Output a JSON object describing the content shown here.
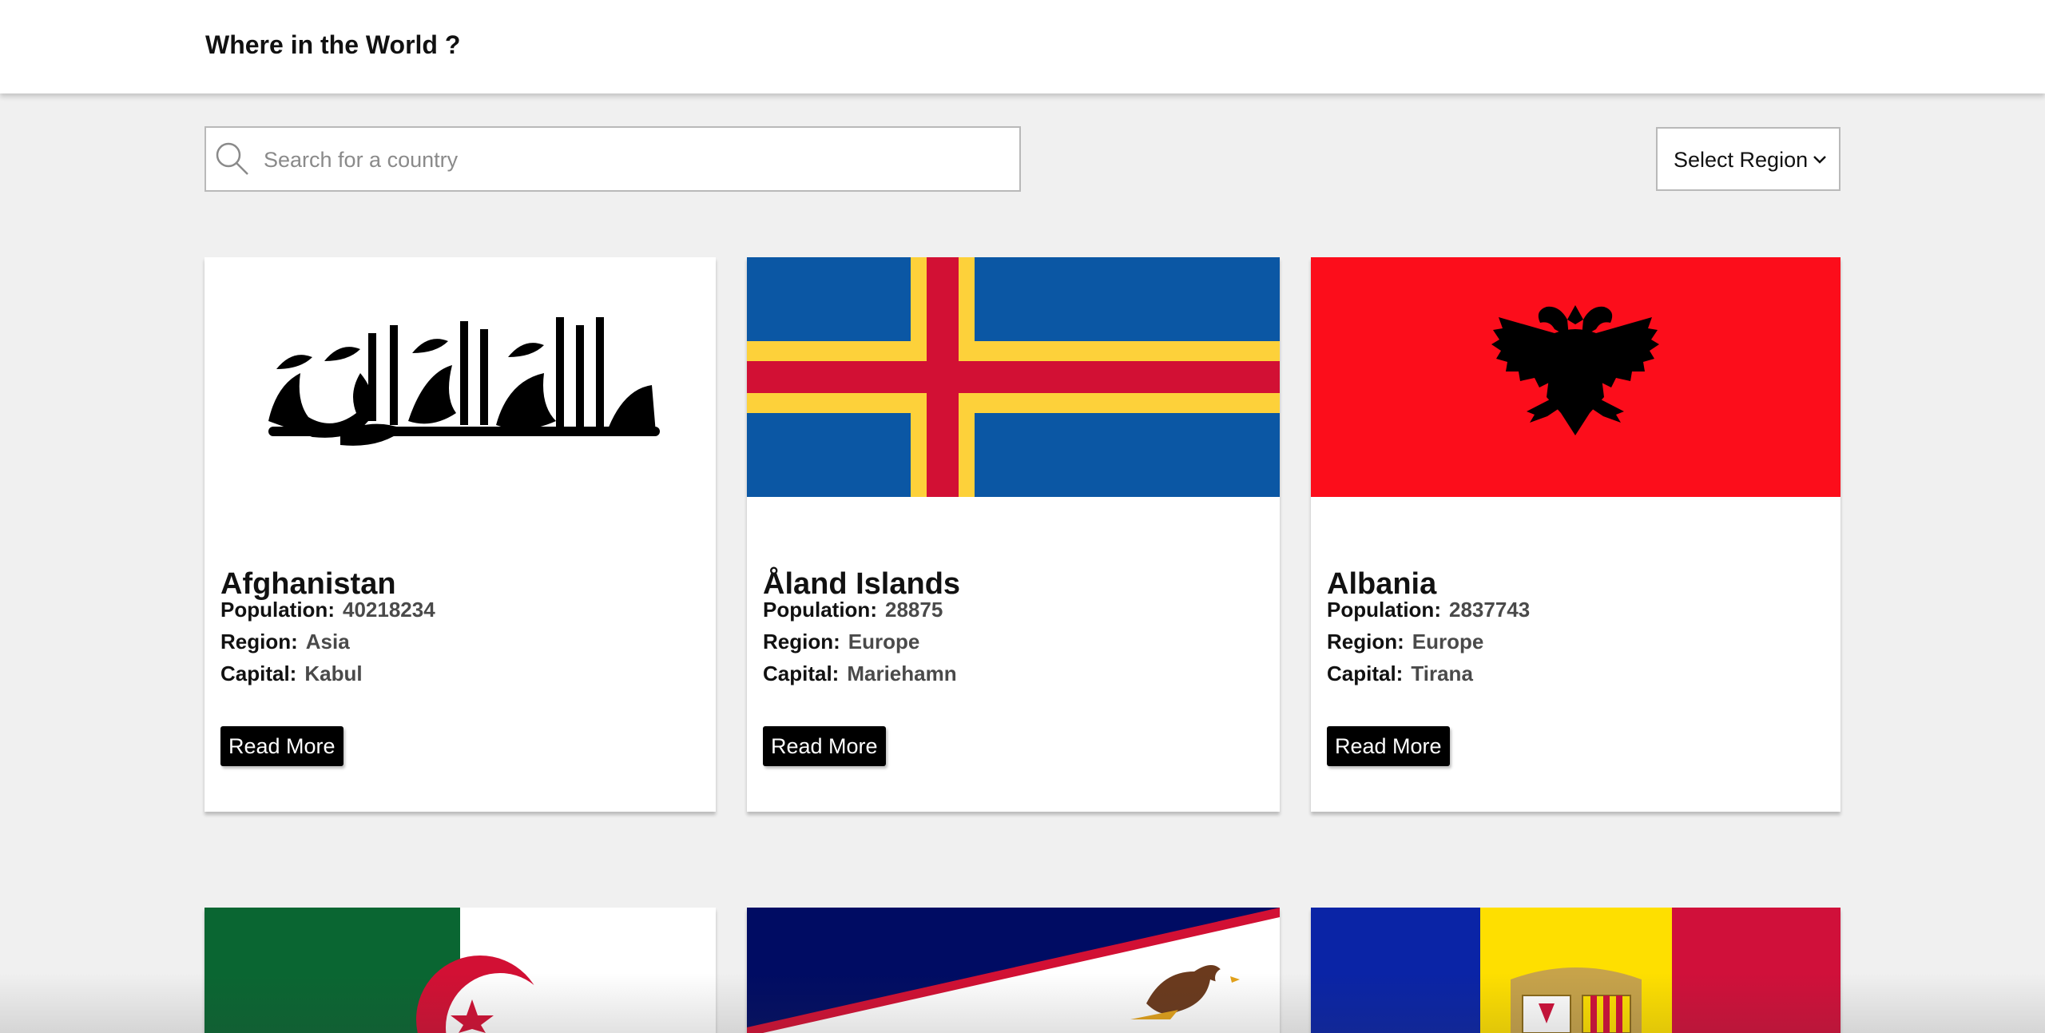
{
  "header": {
    "title": "Where in the World ?"
  },
  "search": {
    "placeholder": "Search for a country",
    "value": ""
  },
  "filter": {
    "label": "Select Region"
  },
  "labels": {
    "population": "Population:",
    "region": "Region:",
    "capital": "Capital:"
  },
  "countries": [
    {
      "name": "Afghanistan",
      "population": "40218234",
      "region": "Asia",
      "capital": "Kabul",
      "button": "Read More"
    },
    {
      "name": "Åland Islands",
      "population": "28875",
      "region": "Europe",
      "capital": "Mariehamn",
      "button": "Read More"
    },
    {
      "name": "Albania",
      "population": "2837743",
      "region": "Europe",
      "capital": "Tirana",
      "button": "Read More"
    }
  ],
  "colors": {
    "background": "#f0f0f0",
    "button": "#000000",
    "aland_blue": "#0b57a4",
    "aland_yellow": "#fdd13a",
    "aland_red": "#d21034",
    "albania_red": "#fc0d1b",
    "algeria_green": "#0a6632",
    "samoa_navy": "#000c63",
    "andorra_blue": "#0a24a6",
    "andorra_yellow": "#fedf00",
    "andorra_red": "#d0103a"
  }
}
